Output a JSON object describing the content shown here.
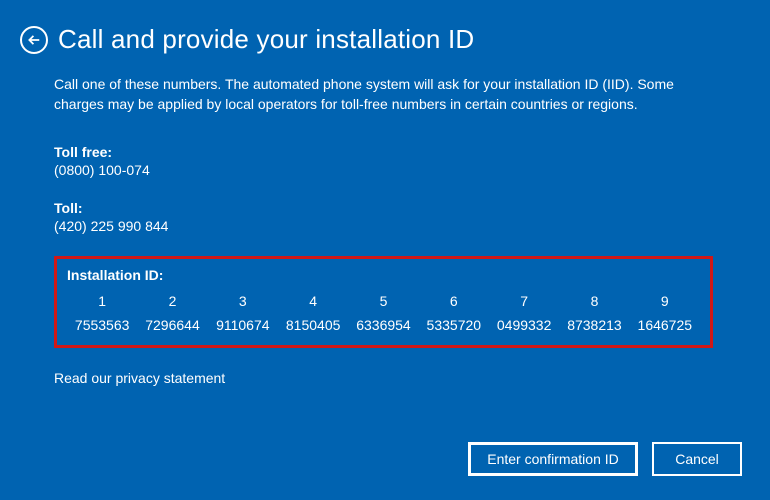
{
  "header": {
    "title": "Call and provide your installation ID"
  },
  "instructions": "Call one of these numbers. The automated phone system will ask for your installation ID (IID). Some charges may be applied by local operators for toll-free numbers in certain countries or regions.",
  "phones": {
    "tollFree": {
      "label": "Toll free:",
      "number": "(0800) 100-074"
    },
    "toll": {
      "label": "Toll:",
      "number": "(420) 225 990 844"
    }
  },
  "installationId": {
    "label": "Installation ID:",
    "indices": [
      "1",
      "2",
      "3",
      "4",
      "5",
      "6",
      "7",
      "8",
      "9"
    ],
    "values": [
      "7553563",
      "7296644",
      "9110674",
      "8150405",
      "6336954",
      "5335720",
      "0499332",
      "8738213",
      "1646725"
    ]
  },
  "privacyLink": "Read our privacy statement",
  "buttons": {
    "confirm": "Enter confirmation ID",
    "cancel": "Cancel"
  }
}
